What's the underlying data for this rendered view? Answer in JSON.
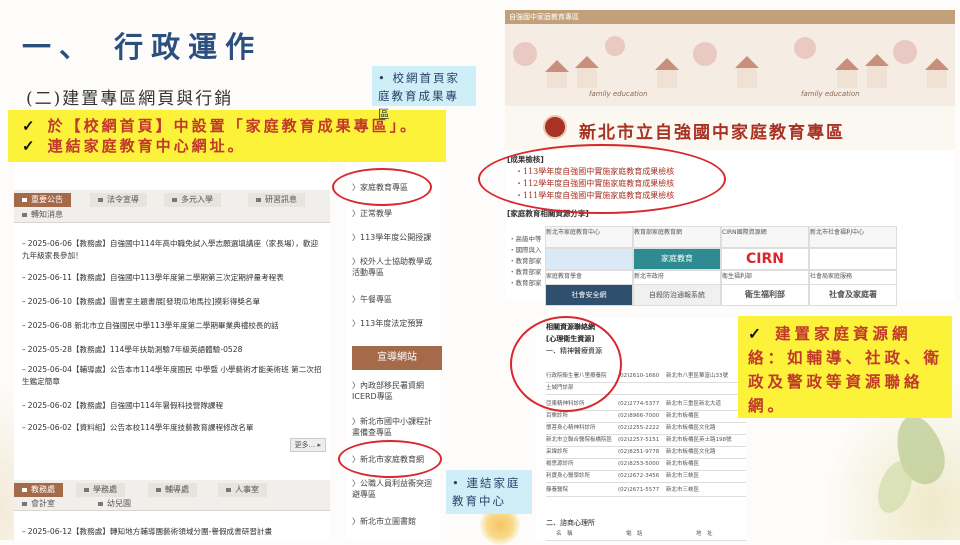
{
  "slide": {
    "title": "一、 行政運作",
    "subtitle": "(二)建置專區網頁與行銷"
  },
  "callouts": {
    "main": [
      "於【校網首頁】中設置「家庭教育成果專區」。",
      "連結家庭教育中心網址。"
    ],
    "resource": "建置家庭資源網絡：如輔導、社政、衛政及警政等資源聯絡網。",
    "homepage_note": "校網首頁家庭教育成果專區",
    "center_note": "連結家庭教育中心",
    "check": "✓"
  },
  "school_site": {
    "tabs_top": [
      {
        "label": "重要公告",
        "active": true
      },
      {
        "label": "法令宣導",
        "active": false
      },
      {
        "label": "多元入學",
        "active": false
      },
      {
        "label": "研習訊息",
        "active": false
      },
      {
        "label": "轉知消息",
        "active": false
      }
    ],
    "news": [
      "2025-06-06【教務處】自強國中114年高中職免試入學志願選填講座（家長場），歡迎九年級家長參加！",
      "2025-06-11【教務處】自強國中113學年度第二學期第三次定期評量考程表",
      "2025-06-10【教務處】圖書室主題書展[發現瓜地馬拉]摸彩得獎名單",
      "2025-06-08 新北市立自強國民中學113學年度第二學期畢業典禮校長的話",
      "2025-05-28【教務處】114學年扶助測驗7年級英語體驗-0528",
      "2025-06-04【輔導處】公告本市114學年度國民 中學暨 小學藝術才能美術班 第二次招生鑑定簡章",
      "2025-06-02【教務處】自強國中114年暑假科技營隊課程",
      "2025-06-02【資料組】公告本校114學年度技藝教育課程修改名單"
    ],
    "more_label": "更多...",
    "more_arrow": "▸",
    "tabs_bottom": [
      {
        "label": "教務處",
        "active": true
      },
      {
        "label": "學務處",
        "active": false
      },
      {
        "label": "輔導處",
        "active": false
      },
      {
        "label": "人事室",
        "active": false
      },
      {
        "label": "會計室",
        "active": false
      },
      {
        "label": "幼兒園",
        "active": false
      }
    ],
    "news_bottom": "2025-06-12【教務處】轉知地方輔導團藝術領域分團-譽假成書研習計畫",
    "sidebar_items": [
      "家庭教育專區",
      "正常教學",
      "113學年度公開授課",
      "校外人士協助教學或活動專區",
      "午餐專區",
      "113年度法定預算"
    ],
    "sidebar_header": "宣導網站",
    "sidebar_links": [
      "內政部移民署資網ICERD專區",
      "新北市國中小課程計畫備查專區",
      "新北市家庭教育網",
      "公職人員利益衝突迴避專區",
      "新北市立圖書館"
    ]
  },
  "family_page": {
    "window_title": "自強國中家庭教育專區",
    "banner_label": "family education",
    "title": "新北市立自強國中家庭教育專區",
    "results_header": "[成果檢核]",
    "results": [
      "113學年度自強國中實施家庭教育成果檢核",
      "112學年度自強國中實施家庭教育成果檢核",
      "111學年度自強國中實施家庭教育成果檢核"
    ],
    "resources_header": "[家庭教育相關資源分享]",
    "left_links": [
      "・高級中等",
      "・國際與入",
      "・教育部家",
      "・教育部家",
      "・教育部家"
    ],
    "resource_tiles": [
      "新北市家庭教育中心",
      "教育部家庭教育網",
      "CIRN國際資源網",
      "新北市社會福利中心",
      "家庭教育學會",
      "新北市政府",
      "衛生福利部",
      "社會局家庭服務",
      "社會安全網",
      "自殺防治通報系統",
      "衛生福利部",
      "社會及家庭署"
    ],
    "tile_logos": {
      "cirn": "CIRN",
      "moe": "家庭教育",
      "mohw": "衛生福利部",
      "sfaa": "社會及家庭署",
      "sen": "社會安全網",
      "suicide": "自殺防治通報系統"
    }
  },
  "contact_table": {
    "title": "相關資源聯絡網",
    "section": "[心理衛生資源]",
    "subsection": "一、精神醫療資源",
    "rows": [
      {
        "name": "行政院衛生署八里療養院",
        "phone": "(02)2610-1660",
        "addr": "新北市八里區華富山33號"
      },
      {
        "name": "土城門診部",
        "phone": "",
        "addr": ""
      },
      {
        "name": "亞東精神科診所",
        "phone": "(02)2774-5377",
        "addr": "新北市三重區新北大道"
      },
      {
        "name": "百樂診所",
        "phone": "(02)8966-7000",
        "addr": "新北市板橋區"
      },
      {
        "name": "懷菩身心精神科診所",
        "phone": "(02)2255-2222",
        "addr": "新北市板橋區文化路"
      },
      {
        "name": "新北市立聯合醫院板橋院區",
        "phone": "(02)2257-5151",
        "addr": "新北市板橋區英士路198號"
      },
      {
        "name": "采煒診所",
        "phone": "(02)8251-9778",
        "addr": "新北市板橋區文化路"
      },
      {
        "name": "楊思源診所",
        "phone": "(02)8253-5000",
        "addr": "新北市板橋區"
      },
      {
        "name": "利寶身心醫學診所",
        "phone": "(02)2672-3456",
        "addr": "新北市三峽區"
      },
      {
        "name": "靜養醫院",
        "phone": "(02)2671-5577",
        "addr": "新北市三峽區"
      }
    ],
    "subsection2": "二、諮商心理所",
    "col_heads": [
      "名　稱",
      "電　話",
      "地　址"
    ]
  }
}
